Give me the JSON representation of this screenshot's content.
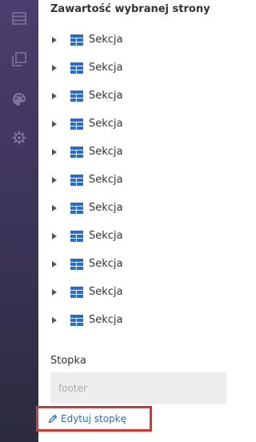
{
  "rail": {
    "icons": [
      "menu-icon",
      "pages-icon",
      "palette-icon",
      "settings-icon"
    ]
  },
  "panel": {
    "title": "Zawartość wybranej strony",
    "sections": [
      {
        "label": "Sekcja"
      },
      {
        "label": "Sekcja"
      },
      {
        "label": "Sekcja"
      },
      {
        "label": "Sekcja"
      },
      {
        "label": "Sekcja"
      },
      {
        "label": "Sekcja"
      },
      {
        "label": "Sekcja"
      },
      {
        "label": "Sekcja"
      },
      {
        "label": "Sekcja"
      },
      {
        "label": "Sekcja"
      },
      {
        "label": "Sekcja"
      }
    ],
    "footer": {
      "label": "Stopka",
      "placeholder": "footer",
      "edit_label": "Edytuj stopkę"
    }
  },
  "colors": {
    "rail_top": "#4b3d6e",
    "rail_bottom": "#2b2b3d",
    "section_icon": "#2a6ad8",
    "link": "#2a6ad8",
    "highlight": "#e0312f"
  }
}
